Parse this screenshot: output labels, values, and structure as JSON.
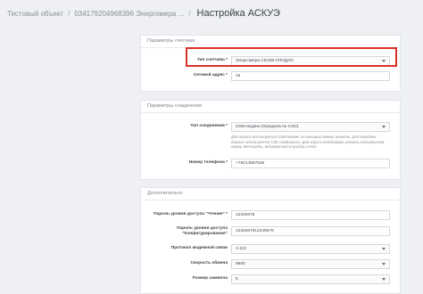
{
  "breadcrumb": {
    "item1": "Тестовый объект",
    "item2": "034179204968396 Энергомера ...",
    "separator": "/",
    "title": "Настройка АСКУЭ"
  },
  "meter_params": {
    "header": "Параметры счетчика",
    "type_label": "Тип счетчика *",
    "type_value": "Энергомера CE208 СПОДЭС",
    "address_label": "Сетевой адрес *",
    "address_value": "16"
  },
  "connection_params": {
    "header": "Параметры соединения",
    "conn_type_label": "Тип соединения *",
    "conn_type_value": "GSM модем (передача по CSD)",
    "conn_hint": "Для опроса используется GSM модем, на который можно звонить. Для передачи данных используется CSD соединение. Для опроса необходимо указать телефонный номер SIM-карты, вставленной в прибор учета",
    "phone_label": "Номер телефона *",
    "phone_value": "+79214587636"
  },
  "additional": {
    "header": "Дополнительно",
    "read_pwd_label": "Пароль уровня доступа \"Чтение\" *",
    "read_pwd_value": "12345678",
    "config_pwd_label": "Пароль уровня доступа \"Конфигурирование\"",
    "config_pwd_value": "1234567812345678",
    "modem_protocol_label": "Протокол модемной связи",
    "modem_protocol_value": "V.110",
    "baud_label": "Скорость обмена",
    "baud_value": "9600",
    "charsize_label": "Размер символа",
    "charsize_value": "8"
  },
  "colors": {
    "highlight": "#d93025",
    "background": "#eef0f3"
  }
}
